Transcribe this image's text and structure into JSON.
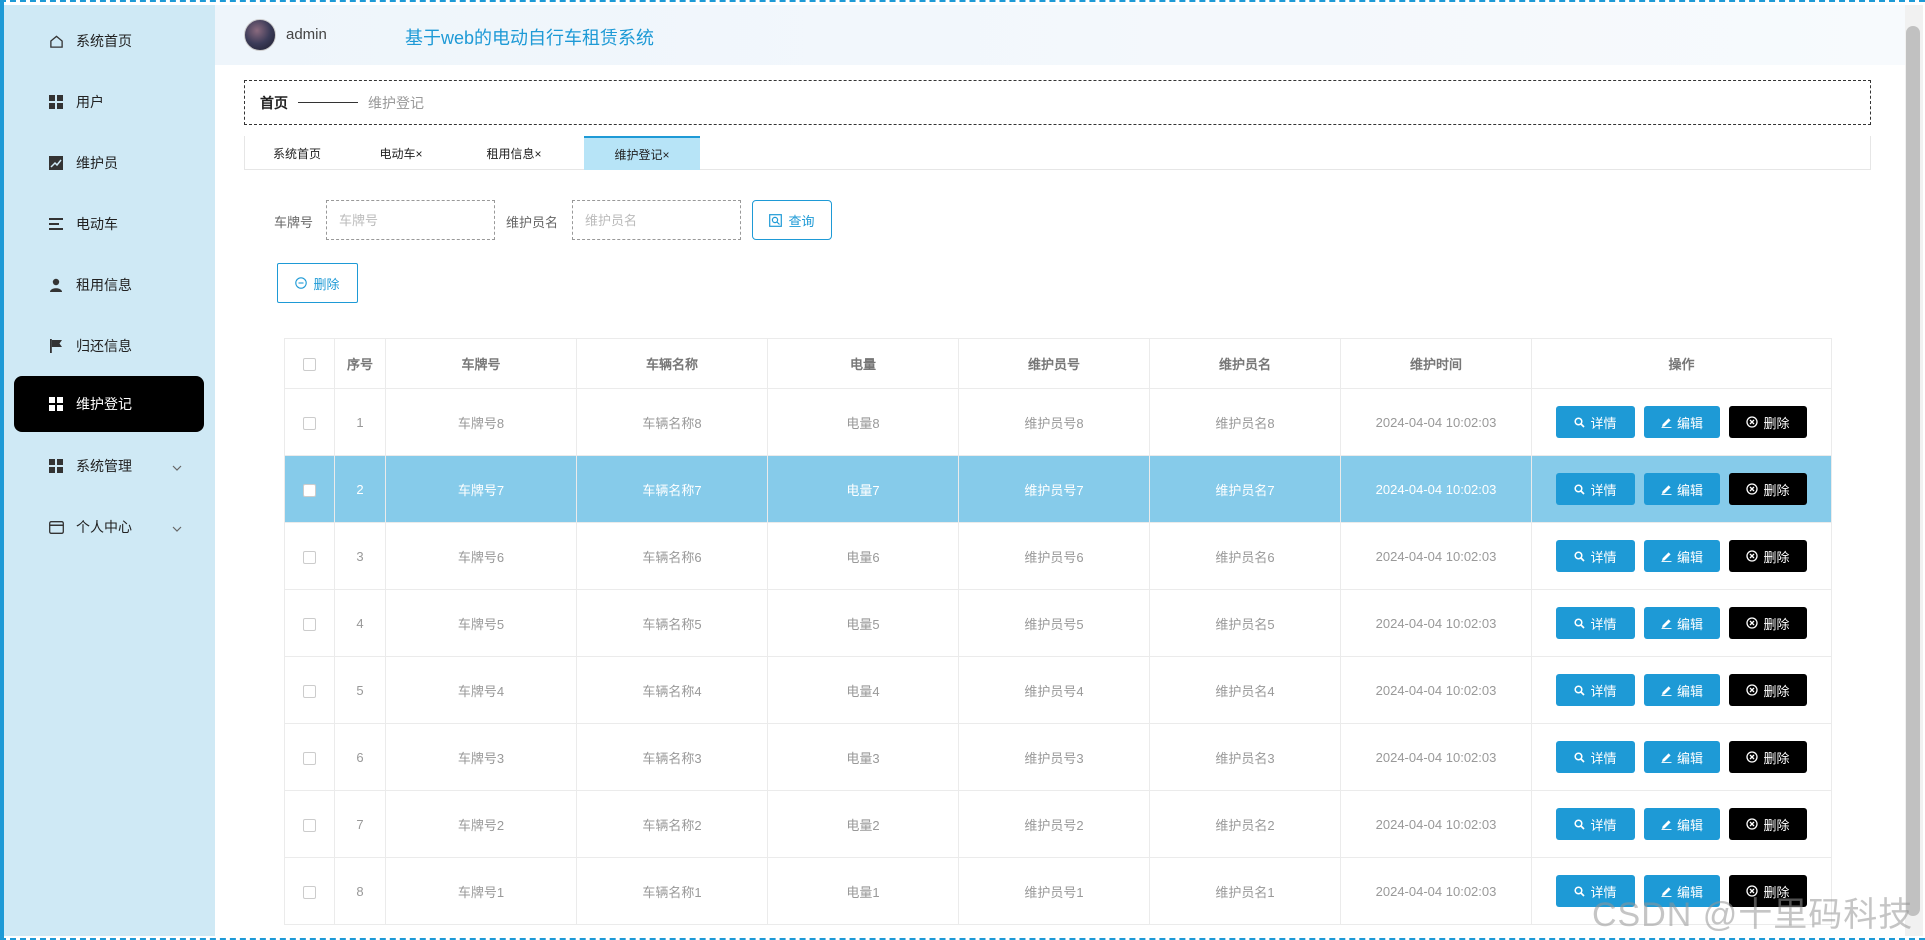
{
  "sidebar": {
    "items": [
      {
        "label": "系统首页",
        "icon": "home-icon"
      },
      {
        "label": "用户",
        "icon": "grid-icon"
      },
      {
        "label": "维护员",
        "icon": "chart-icon"
      },
      {
        "label": "电动车",
        "icon": "list-icon"
      },
      {
        "label": "租用信息",
        "icon": "user-icon"
      },
      {
        "label": "归还信息",
        "icon": "flag-icon"
      },
      {
        "label": "维护登记",
        "icon": "grid-icon",
        "active": true
      },
      {
        "label": "系统管理",
        "icon": "grid-icon",
        "expandable": true
      },
      {
        "label": "个人中心",
        "icon": "card-icon",
        "expandable": true
      }
    ]
  },
  "header": {
    "username": "admin",
    "system_title": "基于web的电动自行车租赁系统"
  },
  "breadcrumb": {
    "home": "首页",
    "current": "维护登记"
  },
  "tabs": [
    {
      "label": "系统首页"
    },
    {
      "label": "电动车×"
    },
    {
      "label": "租用信息×"
    },
    {
      "label": "维护登记×",
      "active": true
    }
  ],
  "search": {
    "plate_label": "车牌号",
    "plate_placeholder": "车牌号",
    "maintainer_label": "维护员名",
    "maintainer_placeholder": "维护员名",
    "query_label": "查询"
  },
  "toolbar": {
    "delete_label": "删除"
  },
  "table": {
    "headers": [
      "序号",
      "车牌号",
      "车辆名称",
      "电量",
      "维护员号",
      "维护员名",
      "维护时间",
      "操作"
    ],
    "rows": [
      [
        "1",
        "车牌号8",
        "车辆名称8",
        "电量8",
        "维护员号8",
        "维护员名8",
        "2024-04-04 10:02:03"
      ],
      [
        "2",
        "车牌号7",
        "车辆名称7",
        "电量7",
        "维护员号7",
        "维护员名7",
        "2024-04-04 10:02:03"
      ],
      [
        "3",
        "车牌号6",
        "车辆名称6",
        "电量6",
        "维护员号6",
        "维护员名6",
        "2024-04-04 10:02:03"
      ],
      [
        "4",
        "车牌号5",
        "车辆名称5",
        "电量5",
        "维护员号5",
        "维护员名5",
        "2024-04-04 10:02:03"
      ],
      [
        "5",
        "车牌号4",
        "车辆名称4",
        "电量4",
        "维护员号4",
        "维护员名4",
        "2024-04-04 10:02:03"
      ],
      [
        "6",
        "车牌号3",
        "车辆名称3",
        "电量3",
        "维护员号3",
        "维护员名3",
        "2024-04-04 10:02:03"
      ],
      [
        "7",
        "车牌号2",
        "车辆名称2",
        "电量2",
        "维护员号2",
        "维护员名2",
        "2024-04-04 10:02:03"
      ],
      [
        "8",
        "车牌号1",
        "车辆名称1",
        "电量1",
        "维护员号1",
        "维护员名1",
        "2024-04-04 10:02:03"
      ]
    ],
    "highlighted_row": 2,
    "actions": {
      "detail": "详情",
      "edit": "编辑",
      "delete": "删除"
    }
  },
  "watermark": "CSDN @十里码科技",
  "colors": {
    "accent": "#1e9ad6",
    "sidebar_bg": "#cfe9f5",
    "active_menu": "#000000",
    "row_highlight": "#86cbea"
  }
}
